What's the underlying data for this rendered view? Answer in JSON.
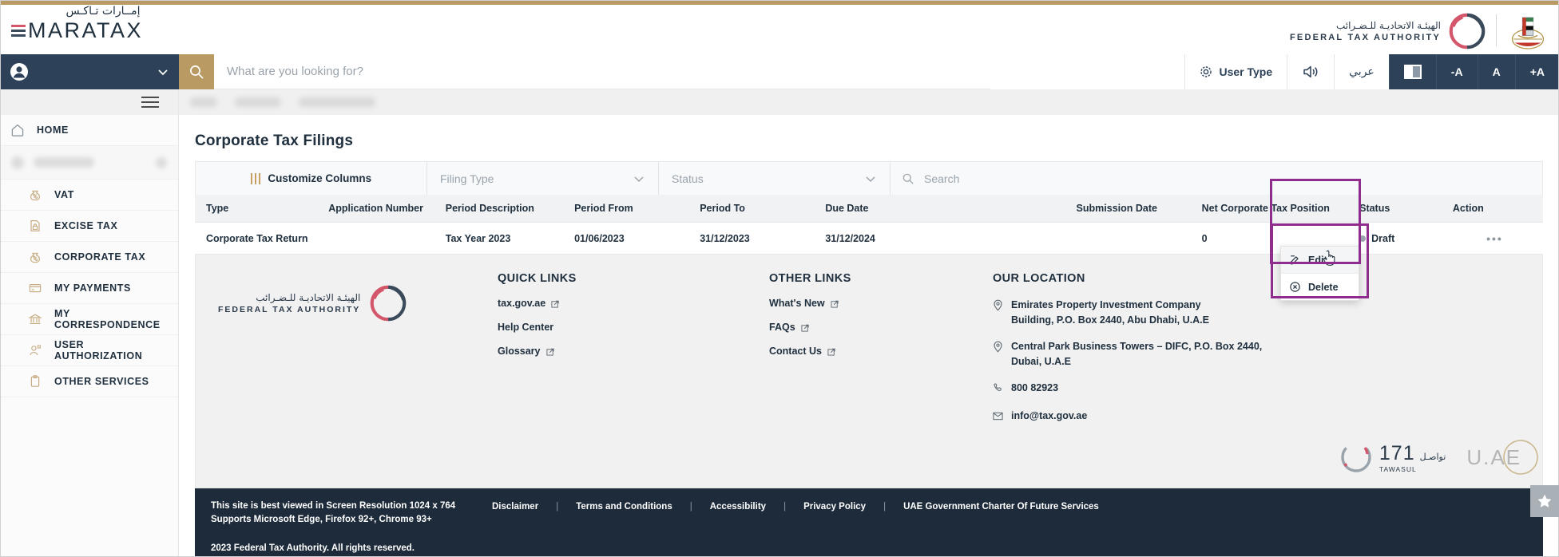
{
  "brand": {
    "logo_arabic": "إمــارات تـاكـس",
    "logo_latin": "MARATAX",
    "fta_arabic": "الهيئـة الاتحاديـة للـضـرائب",
    "fta_english": "FEDERAL TAX AUTHORITY"
  },
  "topbar": {
    "search_placeholder": "What are you looking for?",
    "user_type_label": "User Type",
    "arabic_label": "عربي",
    "font_decrease": "-A",
    "font_normal": "A",
    "font_increase": "+A"
  },
  "sidebar": {
    "items": [
      {
        "label": "HOME",
        "icon": "home-icon"
      },
      {
        "label": "VAT",
        "icon": "money-bag-percent-icon"
      },
      {
        "label": "EXCISE TAX",
        "icon": "document-lock-icon"
      },
      {
        "label": "CORPORATE TAX",
        "icon": "money-bag-percent-icon"
      },
      {
        "label": "MY PAYMENTS",
        "icon": "credit-card-icon"
      },
      {
        "label": "MY CORRESPONDENCE",
        "icon": "bank-building-icon"
      },
      {
        "label": "USER AUTHORIZATION",
        "icon": "user-key-icon"
      },
      {
        "label": "OTHER SERVICES",
        "icon": "clipboard-icon"
      }
    ]
  },
  "main": {
    "page_title": "Corporate Tax Filings",
    "toolbar": {
      "customize_columns": "Customize Columns",
      "filing_type_placeholder": "Filing Type",
      "status_placeholder": "Status",
      "search_placeholder": "Search"
    },
    "table": {
      "columns": [
        "Type",
        "Application Number",
        "Period Description",
        "Period From",
        "Period To",
        "Due Date",
        "Submission Date",
        "Net Corporate Tax Position",
        "Status",
        "Action"
      ],
      "rows": [
        {
          "type": "Corporate Tax Return",
          "application_number": "",
          "period_description": "Tax Year 2023",
          "period_from": "01/06/2023",
          "period_to": "31/12/2023",
          "due_date": "31/12/2024",
          "submission_date": "",
          "net_corporate_tax_position": "0",
          "status": "Draft",
          "action": "•••"
        }
      ]
    },
    "action_menu": {
      "edit": "Edit",
      "delete": "Delete"
    },
    "highlight_color": "#8e2d8e"
  },
  "footer": {
    "quick_links": {
      "heading": "QUICK LINKS",
      "items": [
        {
          "label": "tax.gov.ae",
          "external": true
        },
        {
          "label": "Help Center",
          "external": false
        },
        {
          "label": "Glossary",
          "external": true
        }
      ]
    },
    "other_links": {
      "heading": "OTHER LINKS",
      "items": [
        {
          "label": "What's New",
          "external": true
        },
        {
          "label": "FAQs",
          "external": true
        },
        {
          "label": "Contact Us",
          "external": true
        }
      ]
    },
    "our_location": {
      "heading": "OUR LOCATION",
      "address_1": "Emirates Property Investment Company Building, P.O. Box 2440, Abu Dhabi, U.A.E",
      "address_2": "Central Park Business Towers – DIFC, P.O. Box 2440, Dubai, U.A.E",
      "phone": "800 82923",
      "email": "info@tax.gov.ae"
    },
    "partners": {
      "tawasul_number": "171",
      "tawasul_label": "TAWASUL",
      "tawasul_arabic": "تواصـل",
      "uae_label": "U.AE"
    },
    "bottom": {
      "note_line1": "This site is best viewed in Screen Resolution 1024 x 764",
      "note_line2": "Supports Microsoft Edge, Firefox 92+, Chrome 93+",
      "links": [
        "Disclaimer",
        "Terms and Conditions",
        "Accessibility",
        "Privacy Policy",
        "UAE Government Charter Of Future Services"
      ],
      "separator": "|",
      "copyright": "2023 Federal Tax Authority. All rights reserved."
    }
  }
}
